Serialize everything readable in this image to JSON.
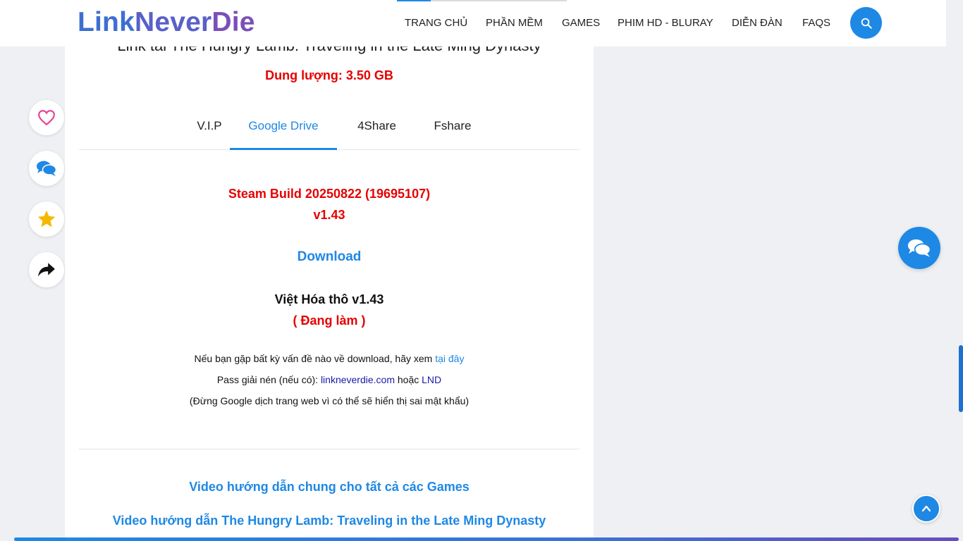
{
  "header": {
    "logo": {
      "part1": "Link",
      "part2": "Never",
      "part3": "Die"
    },
    "nav": [
      "TRANG CHỦ",
      "PHẦN MỀM",
      "GAMES",
      "PHIM HD - BLURAY",
      "DIỄN ĐÀN",
      "FAQS"
    ],
    "search_icon": "search-icon"
  },
  "download_box": {
    "title": "Link tải The Hungry Lamb: Traveling in the Late Ming Dynasty",
    "file_size": "Dung lượng: 3.50 GB",
    "tabs": [
      "V.I.P",
      "Google Drive",
      "4Share",
      "Fshare"
    ],
    "active_tab": "Google Drive",
    "build": "Steam Build 20250822 (19695107)",
    "version": "v1.43",
    "download_label": "Download",
    "viet_hoa": "Việt Hóa thô v1.43",
    "status": "( Đang làm )",
    "help_text": "Nếu bạn gặp bất kỳ vấn đề nào về download, hãy xem",
    "help_link": "tại đây",
    "pass_text": "Pass giải nén (nếu có):",
    "pass_value1": "linkneverdie.com",
    "pass_or": "hoặc",
    "pass_value2": "LND",
    "warning": "(Đừng Google dịch trang web vì có thể sẽ hiển thị sai mật khẩu)"
  },
  "videos": {
    "general": "Video hướng dẫn chung cho tất cả các Games",
    "specific": "Video hướng dẫn The Hungry Lamb: Traveling in the Late Ming Dynasty"
  },
  "side_actions": [
    "heart-icon",
    "comments-icon",
    "star-icon",
    "share-icon"
  ],
  "colors": {
    "accent": "#1e88e5",
    "danger": "#e60000",
    "heart": "#e84393",
    "star": "#f5b800"
  }
}
